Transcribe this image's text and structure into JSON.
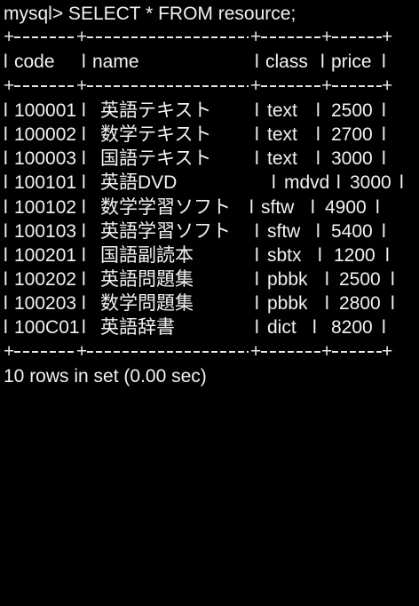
{
  "terminal": {
    "prompt": "mysql> SELECT * FROM resource;",
    "header": {
      "code": "code",
      "name": "name",
      "class": "class",
      "price": "price"
    },
    "rows": [
      {
        "code": "100001",
        "name": "英語テキスト",
        "class": "text",
        "price": "2500"
      },
      {
        "code": "100002",
        "name": "数学テキスト",
        "class": "text",
        "price": "2700"
      },
      {
        "code": "100003",
        "name": "国語テキスト",
        "class": "text",
        "price": "3000"
      },
      {
        "code": "100101",
        "name": "英語DVD",
        "class": "mdvd",
        "price": "3000"
      },
      {
        "code": "100102",
        "name": "数学学習ソフト",
        "class": "sftw",
        "price": "4900"
      },
      {
        "code": "100103",
        "name": "英語学習ソフト",
        "class": "sftw",
        "price": "5400"
      },
      {
        "code": "100201",
        "name": "国語副読本",
        "class": "sbtx",
        "price": "1200"
      },
      {
        "code": "100202",
        "name": "英語問題集",
        "class": "pbbk",
        "price": "2500"
      },
      {
        "code": "100203",
        "name": "数学問題集",
        "class": "pbbk",
        "price": "2800"
      },
      {
        "code": "100C01",
        "name": "英語辞書",
        "class": "dict",
        "price": "8200"
      }
    ],
    "summary": "10 rows in set (0.00 sec)",
    "colors": {
      "background": "#000000",
      "text": "#f2f2f2"
    }
  }
}
